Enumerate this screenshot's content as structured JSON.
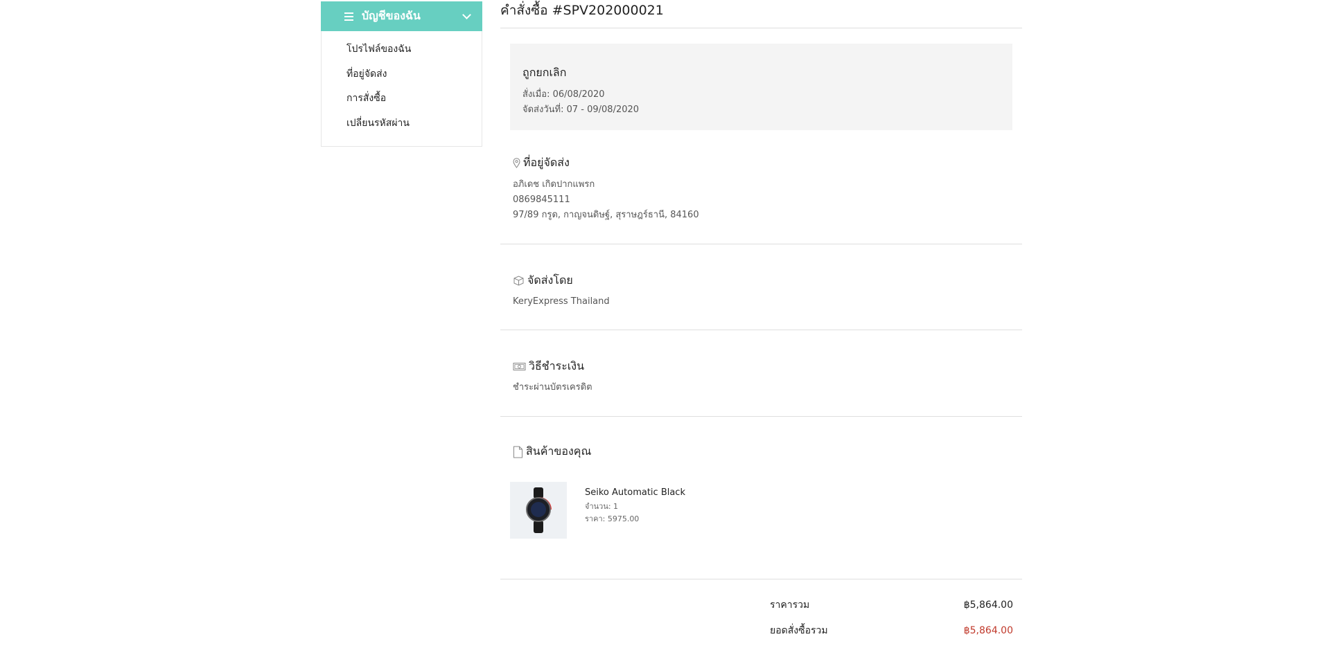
{
  "sidebar": {
    "title": "บัญชีของฉัน",
    "items": [
      {
        "label": "โปรไฟล์ของฉัน"
      },
      {
        "label": "ที่อยู่จัดส่ง"
      },
      {
        "label": "การสั่งซื้อ"
      },
      {
        "label": "เปลี่ยนรหัสผ่าน"
      }
    ]
  },
  "order": {
    "title": "คำสั่งซื้อ #SPV202000021",
    "status": "ถูกยกเลิก",
    "ordered_on": "สั่งเมื่อ: 06/08/2020",
    "ship_dates": "จัดส่งวันที่: 07 - 09/08/2020"
  },
  "address": {
    "heading": "ที่อยู่จัดส่ง",
    "name": "อภิเดช เกิดปากแพรก",
    "phone": "0869845111",
    "line": "97/89 กรูด, กาญจนดิษฐ์, สุราษฎร์ธานี, 84160"
  },
  "shipping": {
    "heading": "จัดส่งโดย",
    "carrier": "KeryExpress Thailand"
  },
  "payment": {
    "heading": "วิธีชำระเงิน",
    "method": "ชำระผ่านบัตรเครดิต"
  },
  "products": {
    "heading": "สินค้าของคุณ",
    "items": [
      {
        "name": "Seiko Automatic Black",
        "qty": "จำนวน: 1",
        "price": "ราคา: 5975.00"
      }
    ]
  },
  "totals": {
    "subtotal_label": "ราคารวม",
    "subtotal_value": "฿5,864.00",
    "grand_label": "ยอดสั่งซื้อรวม",
    "grand_value": "฿5,864.00"
  },
  "colors": {
    "accent": "#67cfc1",
    "total_red": "#c0392b"
  },
  "icons": [
    "menu-icon",
    "chevron-down-icon",
    "location-pin-icon",
    "box-icon",
    "banknote-icon",
    "document-icon"
  ]
}
